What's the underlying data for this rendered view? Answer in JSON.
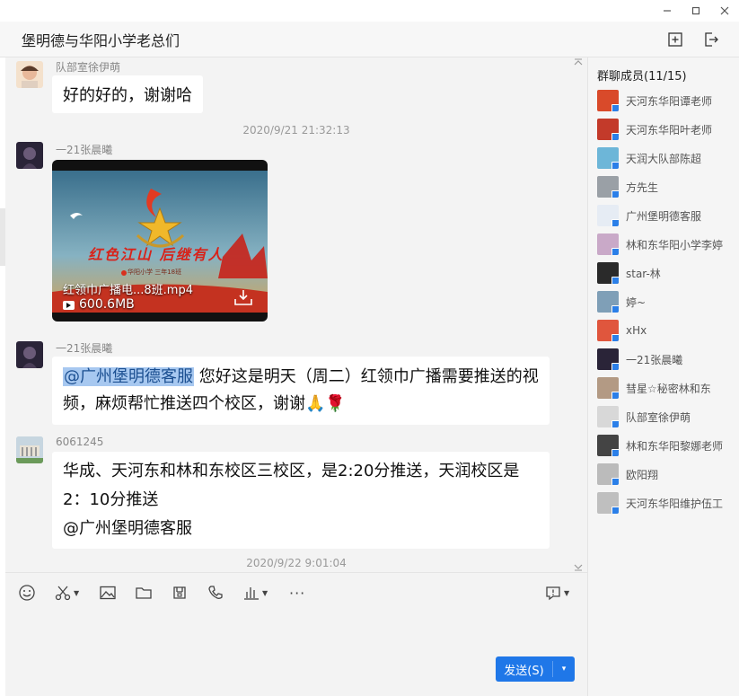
{
  "window": {
    "title": "堡明德与华阳小学老总们",
    "controls": {
      "minimize": "—",
      "maximize": "☐",
      "close": "✕"
    }
  },
  "header_icons": [
    "add-member-icon",
    "exit-icon"
  ],
  "messages": [
    {
      "sender": "队部室徐伊萌",
      "text": "好的好的，谢谢哈"
    },
    {
      "timestamp": "2020/9/21 21:32:13"
    },
    {
      "sender": "一21张晨曦",
      "video": {
        "name": "红领巾广播电...8班.mp4",
        "size": "600.6MB",
        "banner": "红色江山 后继有人",
        "school": "华阳小学 三年18班"
      }
    },
    {
      "sender": "一21张晨曦",
      "mention": "@广州堡明德客服",
      "text": " 您好这是明天（周二）红领巾广播需要推送的视频，麻烦帮忙推送四个校区，谢谢",
      "emojis": [
        "🙏",
        "🌹"
      ]
    },
    {
      "sender": "6061245",
      "lines": [
        "华成、天河东和林和东校区三校区，是2:20分推送，天润校区是",
        "2：10分推送",
        "@广州堡明德客服"
      ]
    },
    {
      "timestamp": "2020/9/22 9:01:04"
    }
  ],
  "toolbar": {
    "icons": [
      "emoji-icon",
      "scissors-icon",
      "image-icon",
      "folder-icon",
      "screenshot-icon",
      "phone-icon",
      "chart-icon",
      "more-icon",
      "history-icon"
    ],
    "more": "···"
  },
  "send": {
    "label": "发送(S)",
    "dropdown": "▾"
  },
  "members": {
    "title": "群聊成员(11/15)",
    "list": [
      {
        "name": "天河东华阳谭老师",
        "color": "#d94a2a"
      },
      {
        "name": "天河东华阳叶老师",
        "color": "#c33a2a"
      },
      {
        "name": "天润大队部陈超",
        "color": "#6db6d8"
      },
      {
        "name": "方先生",
        "color": "#9aa0a6"
      },
      {
        "name": "广州堡明德客服",
        "color": "#e6ecf4"
      },
      {
        "name": "林和东华阳小学李婷",
        "color": "#c9a9c8"
      },
      {
        "name": "star-林",
        "color": "#2a2a2a"
      },
      {
        "name": "婷~",
        "color": "#7f9fb7"
      },
      {
        "name": "xHx",
        "color": "#e0563d"
      },
      {
        "name": "一21张晨曦",
        "color": "#2a2438"
      },
      {
        "name": "彗星☆秘密林和东",
        "color": "#b39a84"
      },
      {
        "name": "队部室徐伊萌",
        "color": "#d8d8d8"
      },
      {
        "name": "林和东华阳黎娜老师",
        "color": "#444"
      },
      {
        "name": "欧阳翔",
        "color": "#bbbbbb"
      },
      {
        "name": "天河东华阳维护伍工",
        "color": "#bfbfbf"
      }
    ]
  }
}
